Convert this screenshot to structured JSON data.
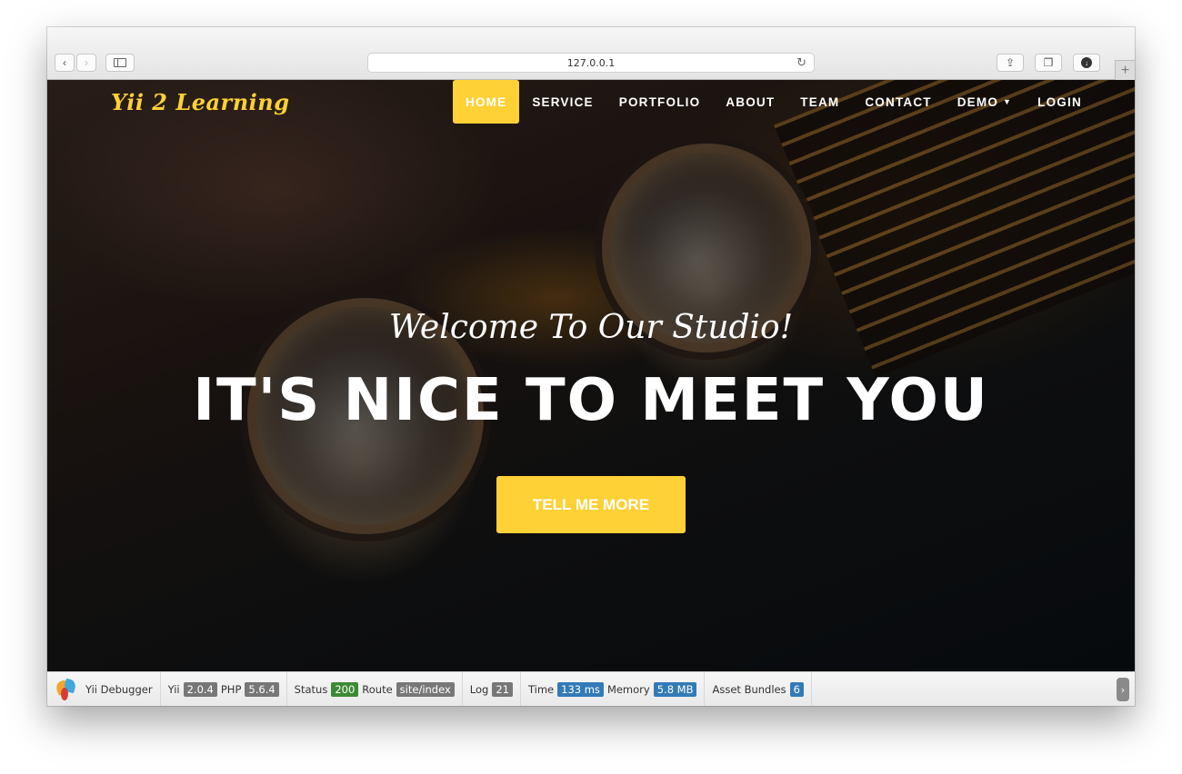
{
  "browser": {
    "url": "127.0.0.1",
    "icons": {
      "back": "chevron-left-icon",
      "forward": "chevron-right-icon",
      "sidebar": "sidebar-icon",
      "reload": "reload-icon",
      "share": "share-icon",
      "tabs": "tabs-icon",
      "download": "download-icon",
      "new_tab": "plus-icon"
    }
  },
  "site": {
    "brand": "Yii 2 Learning",
    "nav": [
      {
        "label": "HOME",
        "active": true
      },
      {
        "label": "SERVICE"
      },
      {
        "label": "PORTFOLIO"
      },
      {
        "label": "ABOUT"
      },
      {
        "label": "TEAM"
      },
      {
        "label": "CONTACT"
      },
      {
        "label": "DEMO",
        "dropdown": true
      },
      {
        "label": "LOGIN"
      }
    ],
    "hero": {
      "subtitle": "Welcome To Our Studio!",
      "headline": "IT'S NICE TO MEET YOU",
      "cta": "TELL ME MORE"
    },
    "colors": {
      "accent": "#fed136",
      "text": "#ffffff"
    }
  },
  "debugbar": {
    "title": "Yii Debugger",
    "yii_label": "Yii",
    "yii_version": "2.0.4",
    "php_label": "PHP",
    "php_version": "5.6.4",
    "status_label": "Status",
    "status_value": "200",
    "route_label": "Route",
    "route_value": "site/index",
    "log_label": "Log",
    "log_value": "21",
    "time_label": "Time",
    "time_value": "133 ms",
    "memory_label": "Memory",
    "memory_value": "5.8 MB",
    "assets_label": "Asset Bundles",
    "assets_value": "6",
    "toggle_icon": "chevron-right-icon"
  }
}
